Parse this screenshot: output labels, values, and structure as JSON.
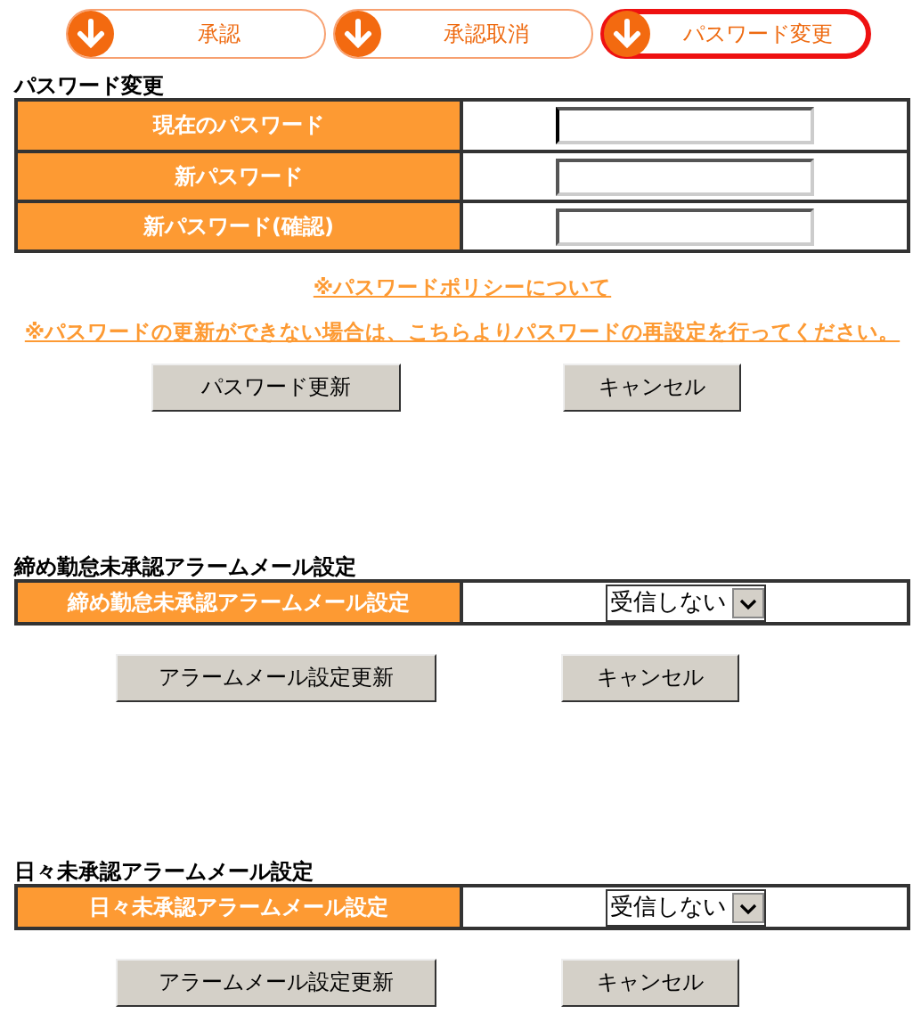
{
  "tabs": [
    {
      "label": "承認",
      "selected": false
    },
    {
      "label": "承認取消",
      "selected": false
    },
    {
      "label": "パスワード変更",
      "selected": true
    }
  ],
  "password_section": {
    "title": "パスワード変更",
    "fields": [
      {
        "label": "現在のパスワード",
        "focused": true
      },
      {
        "label": "新パスワード",
        "focused": false
      },
      {
        "label": "新パスワード(確認)",
        "focused": false
      }
    ],
    "links": [
      "※パスワードポリシーについて",
      "※パスワードの更新ができない場合は、こちらよりパスワードの再設定を行ってください。"
    ],
    "buttons": [
      "パスワード更新",
      "キャンセル"
    ]
  },
  "alarm_sections": [
    {
      "title": "締め勤怠未承認アラームメール設定",
      "label": "締め勤怠未承認アラームメール設定",
      "value": "受信しない",
      "buttons": [
        "アラームメール設定更新",
        "キャンセル"
      ]
    },
    {
      "title": "日々未承認アラームメール設定",
      "label": "日々未承認アラームメール設定",
      "value": "受信しない",
      "buttons": [
        "アラームメール設定更新",
        "キャンセル"
      ]
    }
  ]
}
